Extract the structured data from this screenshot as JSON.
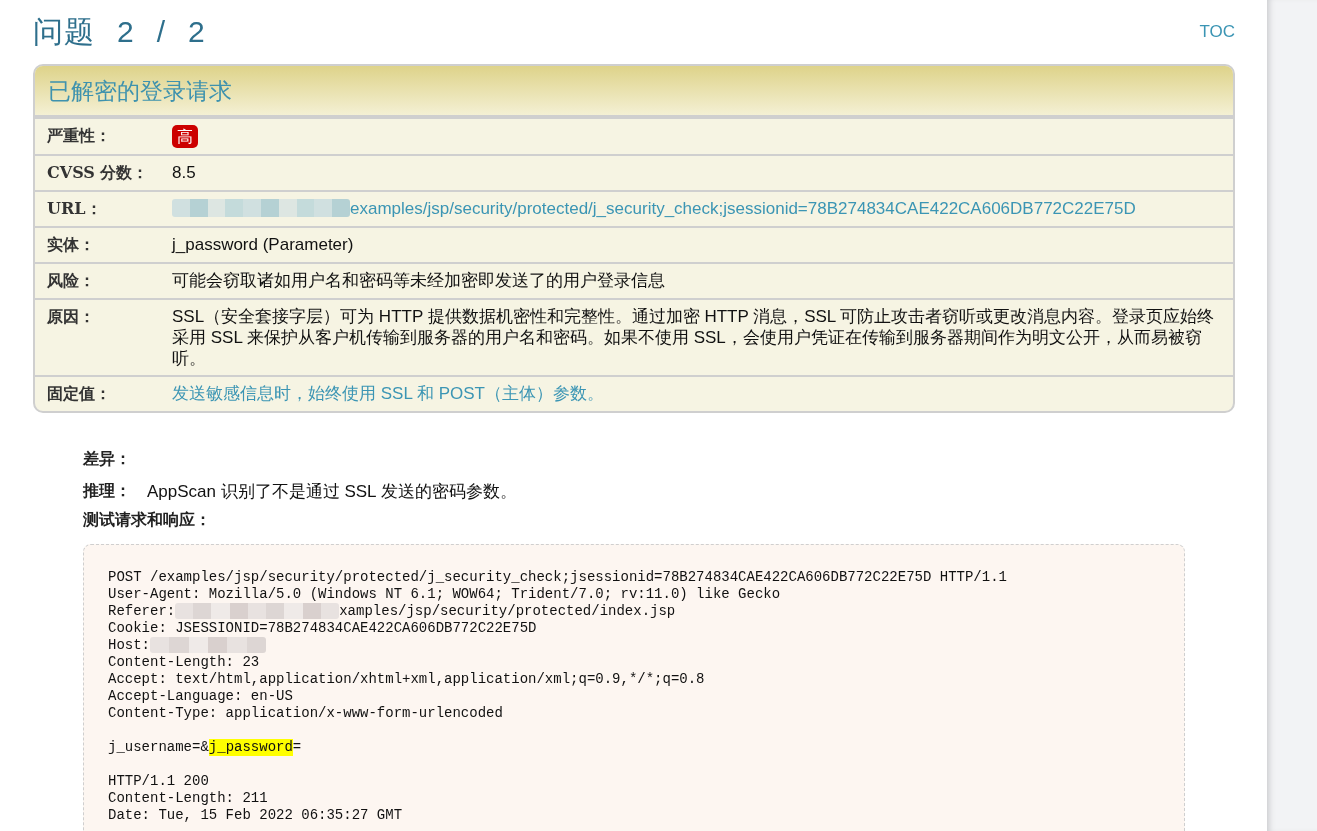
{
  "heading": {
    "title": "问题",
    "index": "2",
    "separator": "/",
    "total": "2"
  },
  "toc_link": "TOC",
  "issue": {
    "title": "已解密的登录请求",
    "rows": [
      {
        "label": "严重性：",
        "kind": "badge",
        "value": "高"
      },
      {
        "label": "CVSS 分数：",
        "kind": "text",
        "value": "8.5"
      },
      {
        "label": "URL：",
        "kind": "link",
        "redacted": true,
        "value": "examples/jsp/security/protected/j_security_check;jsessionid=78B274834CAE422CA606DB772C22E75D"
      },
      {
        "label": "实体：",
        "kind": "text",
        "value": "j_password (Parameter)"
      },
      {
        "label": "风险：",
        "kind": "text",
        "value": "可能会窃取诸如用户名和密码等未经加密即发送了的用户登录信息"
      },
      {
        "label": "原因：",
        "kind": "text",
        "value": "SSL（安全套接字层）可为 HTTP 提供数据机密性和完整性。通过加密 HTTP 消息，SSL 可防止攻击者窃听或更改消息内容。登录页应始终采用 SSL 来保护从客户机传输到服务器的用户名和密码。如果不使用 SSL，会使用户凭证在传输到服务器期间作为明文公开，从而易被窃听。"
      },
      {
        "label": "固定值：",
        "kind": "link",
        "redacted": false,
        "value": "发送敏感信息时，始终使用 SSL 和 POST（主体）参数。"
      }
    ]
  },
  "details": {
    "diff_label": "差异：",
    "reasoning_label": "推理：",
    "reasoning": "AppScan 识别了不是通过 SSL 发送的密码参数。",
    "test_label": "测试请求和响应："
  },
  "code_lines": [
    {
      "kind": "text",
      "text": "POST /examples/jsp/security/protected/j_security_check;jsessionid=78B274834CAE422CA606DB772C22E75D HTTP/1.1"
    },
    {
      "kind": "text",
      "text": "User-Agent: Mozilla/5.0 (Windows NT 6.1; WOW64; Trident/7.0; rv:11.0) like Gecko"
    },
    {
      "kind": "segments",
      "segments": [
        {
          "kind": "text",
          "text": "Referer:"
        },
        {
          "kind": "widemask"
        },
        {
          "kind": "text",
          "text": "xamples/jsp/security/protected/index.jsp"
        }
      ]
    },
    {
      "kind": "text",
      "text": "Cookie: JSESSIONID=78B274834CAE422CA606DB772C22E75D"
    },
    {
      "kind": "segments",
      "segments": [
        {
          "kind": "text",
          "text": "Host:"
        },
        {
          "kind": "narrowmask"
        }
      ]
    },
    {
      "kind": "text",
      "text": "Content-Length: 23"
    },
    {
      "kind": "text",
      "text": "Accept: text/html,application/xhtml+xml,application/xml;q=0.9,*/*;q=0.8"
    },
    {
      "kind": "text",
      "text": "Accept-Language: en-US"
    },
    {
      "kind": "text",
      "text": "Content-Type: application/x-www-form-urlencoded"
    },
    {
      "kind": "blank"
    },
    {
      "kind": "segments",
      "segments": [
        {
          "kind": "text",
          "text": "j_username=&"
        },
        {
          "kind": "highlight",
          "text": "j_password"
        },
        {
          "kind": "text",
          "text": "="
        }
      ]
    },
    {
      "kind": "blank"
    },
    {
      "kind": "text",
      "text": "HTTP/1.1 200"
    },
    {
      "kind": "text",
      "text": "Content-Length: 211"
    },
    {
      "kind": "text",
      "text": "Date: Tue, 15 Feb 2022 06:35:27 GMT"
    }
  ]
}
